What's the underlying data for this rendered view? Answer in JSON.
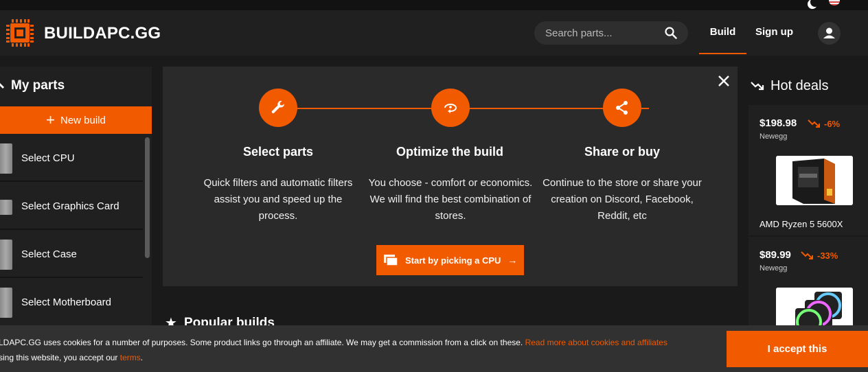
{
  "brand": {
    "name": "BUILDAPC.GG",
    "accent": "#f25a00"
  },
  "header": {
    "search_placeholder": "Search parts...",
    "nav_build": "Build",
    "nav_signup": "Sign up"
  },
  "sidebar": {
    "title": "My parts",
    "new_build": "New build",
    "items": [
      {
        "label": "Select CPU"
      },
      {
        "label": "Select Graphics Card"
      },
      {
        "label": "Select Case"
      },
      {
        "label": "Select Motherboard"
      }
    ]
  },
  "steps": [
    {
      "title": "Select parts",
      "desc": "Quick filters and automatic filters assist you and speed up the process.",
      "icon": "wrench-icon"
    },
    {
      "title": "Optimize the build",
      "desc": "You choose - comfort or economics. We will find the best combination of stores.",
      "icon": "optimize-icon"
    },
    {
      "title": "Share or buy",
      "desc": "Continue to the store or share your creation on Discord, Facebook, Reddit, etc",
      "icon": "share-icon"
    }
  ],
  "cta": {
    "label": "Start by picking a CPU"
  },
  "popular": {
    "title": "Popular builds"
  },
  "deals": {
    "title": "Hot deals",
    "items": [
      {
        "price": "$198.98",
        "discount": "-6%",
        "store": "Newegg",
        "name": "AMD Ryzen 5 5600X"
      },
      {
        "price": "$89.99",
        "discount": "-33%",
        "store": "Newegg",
        "name": ""
      }
    ]
  },
  "cookie": {
    "text_1": "LDAPC.GG uses cookies for a number of purposes. Some product links go through an affiliate. We may get a commission from a click on these. ",
    "link_1": "Read more about cookies and affiliates",
    "text_2": "sing this website, you accept our ",
    "link_2": "terms",
    "text_3": ".",
    "accept": "I accept this"
  }
}
